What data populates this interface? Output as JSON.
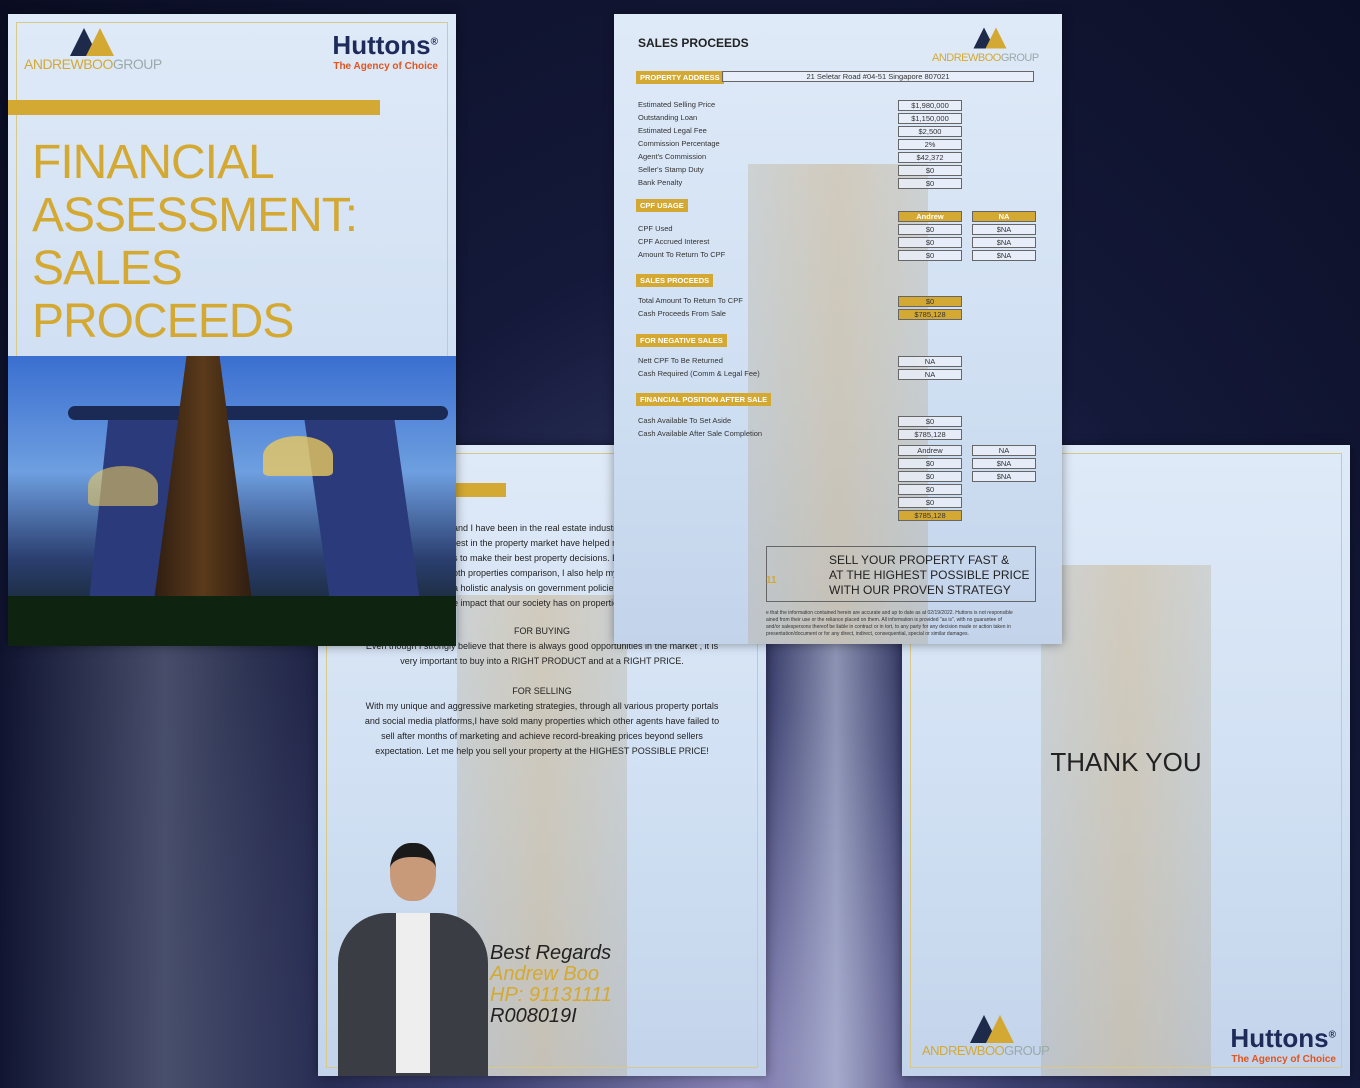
{
  "brand": {
    "group_logo": "ANDREWBOOGROUP",
    "group_a": "ANDREWBOO",
    "group_b": "GROUP",
    "huttons": "Huttons",
    "reg": "®",
    "tagline": "The Agency of Choice"
  },
  "cover": {
    "title_lines": [
      "FINANCIAL",
      "ASSESSMENT:",
      "SALES",
      "PROCEEDS"
    ]
  },
  "sales": {
    "title": "SALES PROCEEDS",
    "property_address_label": "PROPERTY ADDRESS",
    "property_address": "21 Seletar Road #04-51 Singapore 807021",
    "rows": [
      {
        "label": "Estimated Selling Price",
        "value": "$1,980,000"
      },
      {
        "label": "Outstanding Loan",
        "value": "$1,150,000"
      },
      {
        "label": "Estimated Legal Fee",
        "value": "$2,500"
      },
      {
        "label": "Commission Percentage",
        "value": "2%"
      },
      {
        "label": "Agent's Commission",
        "value": "$42,372"
      },
      {
        "label": "Seller's Stamp Duty",
        "value": "$0"
      },
      {
        "label": "Bank Penalty",
        "value": "$0"
      }
    ],
    "cpf_usage": {
      "heading": "CPF USAGE",
      "col1": "Andrew",
      "col2": "NA",
      "rows": [
        {
          "label": "CPF Used",
          "v1": "$0",
          "v2": "$NA"
        },
        {
          "label": "CPF Accrued Interest",
          "v1": "$0",
          "v2": "$NA"
        },
        {
          "label": "Amount To Return To CPF",
          "v1": "$0",
          "v2": "$NA"
        }
      ]
    },
    "proceeds": {
      "heading": "SALES PROCEEDS",
      "rows": [
        {
          "label": "Total Amount To Return To CPF",
          "value": "$0"
        },
        {
          "label": "Cash Proceeds From Sale",
          "value": "$785,128"
        }
      ]
    },
    "negative": {
      "heading": "FOR NEGATIVE SALES",
      "rows": [
        {
          "label": "Nett CPF To Be Returned",
          "value": "NA"
        },
        {
          "label": "Cash Required (Comm & Legal Fee)",
          "value": "NA"
        }
      ]
    },
    "position": {
      "heading": "FINANCIAL POSITION AFTER SALE",
      "rows": [
        {
          "label": "Cash Available To Set Aside",
          "value": "$0"
        },
        {
          "label": "Cash Available After Sale Completion",
          "value": "$785,128"
        }
      ],
      "col1": "Andrew",
      "col2": "NA",
      "col1_values": [
        "$0",
        "$0",
        "$0",
        "$0",
        "$785,128"
      ],
      "col2_values": [
        "$NA",
        "$NA"
      ]
    },
    "slogan_lines": [
      "SELL  YOUR  PROPERTY  FAST  &",
      "AT THE HIGHEST POSSIBLE PRICE",
      "WITH OUR PROVEN STRATEGY"
    ],
    "disclaimer_lines": [
      "e that the information contained herein are accurate and up to date as at 02/19/2022. Huttons is not responsible",
      "ained from their use or the reliance placed on them. All information is provided \"as is\", with no guarantee of",
      "and/or salespersons thereof be liable in contract or in tort, to any party for any decision made or action taken in",
      "presentation/document or for any direct, indirect, consequential, special or similar damages."
    ],
    "partial_number": "11"
  },
  "about": {
    "intro_lines": [
      "and I have been in the real estate industry since 2007. My vast",
      "rest in the property market have helped many property owners,",
      "s to make their best property decisions. Besides analysing price",
      "oth properties comparison, I also help my clients to understand the",
      "a holistic analysis on government policies, URA Master Plan and",
      "e impact that our society has on properties."
    ],
    "buying_heading": "FOR BUYING",
    "buying_lines": [
      "Even though I strongly believe that there is always good opportunities in the market , it is",
      "very important to buy into a RIGHT PRODUCT and at a RIGHT PRICE."
    ],
    "selling_heading": "FOR SELLING",
    "selling_lines": [
      "With my unique and aggressive marketing strategies, through all various property portals",
      "and social media platforms,I have sold many properties which other agents have failed to",
      "sell after months of marketing and achieve record-breaking prices beyond sellers",
      "expectation. Let me help you sell your property at the HIGHEST POSSIBLE PRICE!"
    ],
    "regards": "Best Regards",
    "name": "Andrew Boo",
    "phone": "HP: 91131111",
    "reg_no": "R008019I"
  },
  "thanks": {
    "text": "THANK YOU"
  },
  "colors": {
    "gold": "#d4a933",
    "navy": "#1d2a5a",
    "orange": "#e0541e"
  }
}
